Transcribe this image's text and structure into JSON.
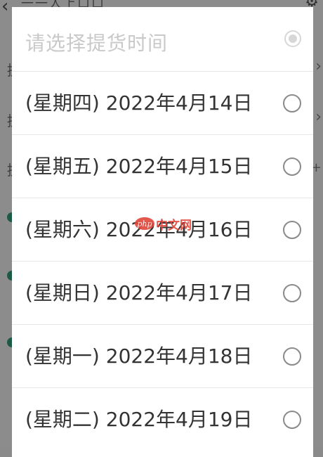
{
  "background": {
    "back_icon": "chevron-left-icon",
    "title": "一一人上口口",
    "settings_icon": "gear-icon",
    "row_chars": [
      "提",
      "提",
      "提"
    ],
    "chevron": "›",
    "dots": 3
  },
  "dialog": {
    "title": "请选择提货时间",
    "selected": true,
    "options": [
      {
        "label": "(星期四) 2022年4月14日"
      },
      {
        "label": "(星期五) 2022年4月15日"
      },
      {
        "label": "(星期六) 2022年4月16日"
      },
      {
        "label": "(星期日) 2022年4月17日"
      },
      {
        "label": "(星期一) 2022年4月18日"
      },
      {
        "label": "(星期二) 2022年4月19日"
      }
    ]
  },
  "watermark": {
    "logo": "php",
    "text": "中文网"
  },
  "colors": {
    "overlay": "#8a8a8a",
    "dialog_bg": "#ffffff",
    "title_text": "#c9c9c9",
    "option_text": "#333333",
    "radio_border": "#8a8a8a",
    "watermark": "#e0453a"
  }
}
